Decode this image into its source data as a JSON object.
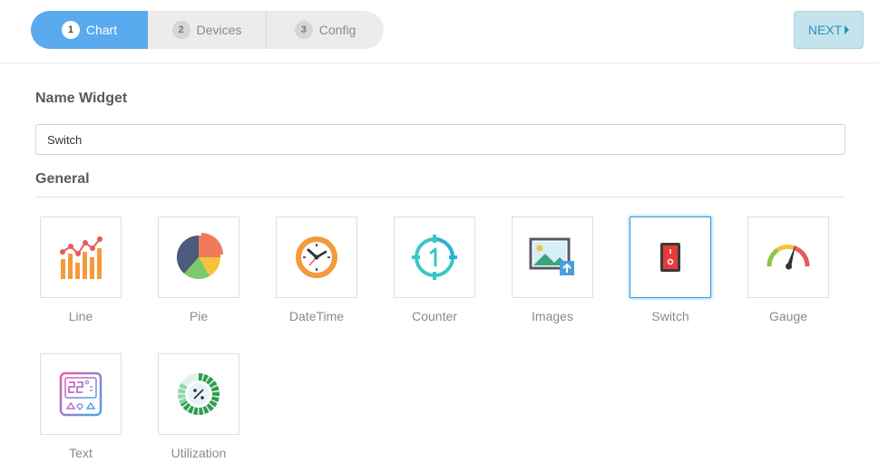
{
  "stepper": {
    "steps": [
      {
        "num": "1",
        "label": "Chart"
      },
      {
        "num": "2",
        "label": "Devices"
      },
      {
        "num": "3",
        "label": "Config"
      }
    ],
    "active_step": 1
  },
  "next_button": {
    "label": "NEXT"
  },
  "form": {
    "name_label": "Name Widget",
    "name_value": "Switch",
    "general_label": "General"
  },
  "widgets": [
    {
      "label": "Line",
      "icon": "line-chart-icon"
    },
    {
      "label": "Pie",
      "icon": "pie-chart-icon"
    },
    {
      "label": "DateTime",
      "icon": "clock-icon"
    },
    {
      "label": "Counter",
      "icon": "counter-icon"
    },
    {
      "label": "Images",
      "icon": "image-upload-icon"
    },
    {
      "label": "Switch",
      "icon": "switch-icon",
      "selected": true
    },
    {
      "label": "Gauge",
      "icon": "gauge-icon"
    },
    {
      "label": "Text",
      "icon": "thermostat-display-icon"
    },
    {
      "label": "Utilization",
      "icon": "utilization-donut-icon"
    }
  ],
  "colors": {
    "accent": "#5aaaf0",
    "next_bg": "#c4e3ec",
    "next_text": "#2f8fbf",
    "selected_border": "#2aa3d6"
  }
}
